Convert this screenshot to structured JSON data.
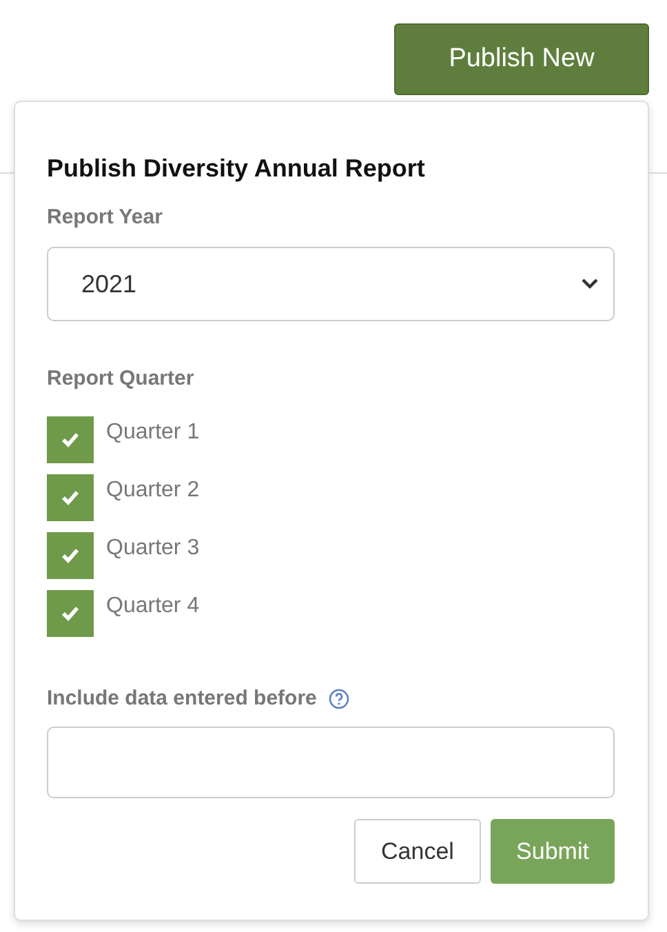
{
  "publish_button": {
    "label": "Publish New"
  },
  "popover": {
    "title": "Publish Diversity Annual Report",
    "year": {
      "label": "Report Year",
      "value": "2021"
    },
    "quarters": {
      "label": "Report Quarter",
      "items": [
        {
          "label": "Quarter 1",
          "checked": true
        },
        {
          "label": "Quarter 2",
          "checked": true
        },
        {
          "label": "Quarter 3",
          "checked": true
        },
        {
          "label": "Quarter 4",
          "checked": true
        }
      ]
    },
    "before": {
      "label": "Include data entered before"
    },
    "buttons": {
      "cancel": "Cancel",
      "submit": "Submit"
    }
  }
}
